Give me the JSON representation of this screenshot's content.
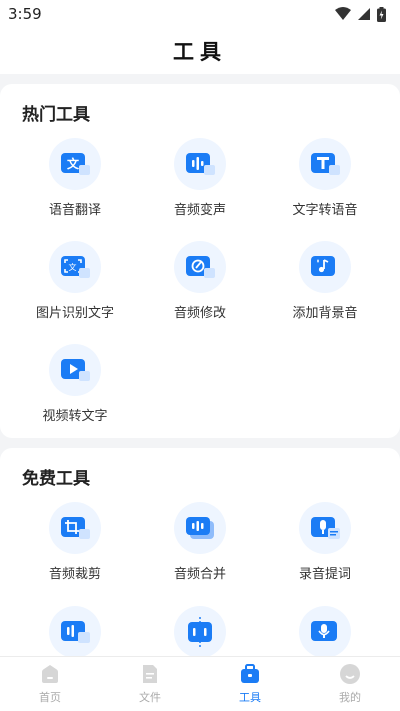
{
  "status_bar": {
    "time": "3:59"
  },
  "header": {
    "title": "工具"
  },
  "hot_tools": {
    "title": "热门工具",
    "items": [
      {
        "label": "语音翻译",
        "icon": "translate-icon"
      },
      {
        "label": "音频变声",
        "icon": "voice-change-icon"
      },
      {
        "label": "文字转语音",
        "icon": "text-to-speech-icon"
      },
      {
        "label": "图片识别文字",
        "icon": "image-ocr-icon"
      },
      {
        "label": "音频修改",
        "icon": "audio-edit-icon"
      },
      {
        "label": "添加背景音",
        "icon": "background-music-icon"
      },
      {
        "label": "视频转文字",
        "icon": "video-to-text-icon"
      }
    ]
  },
  "free_tools": {
    "title": "免费工具",
    "items": [
      {
        "label": "音频裁剪",
        "icon": "crop-audio-icon"
      },
      {
        "label": "音频合并",
        "icon": "merge-audio-icon"
      },
      {
        "label": "录音提词",
        "icon": "teleprompter-icon"
      },
      {
        "label": "",
        "icon": "audio-convert-icon"
      },
      {
        "label": "",
        "icon": "audio-split-icon"
      },
      {
        "label": "",
        "icon": "microphone-icon"
      }
    ]
  },
  "bottom_nav": {
    "items": [
      {
        "label": "首页",
        "icon": "home-icon",
        "active": false
      },
      {
        "label": "文件",
        "icon": "file-icon",
        "active": false
      },
      {
        "label": "工具",
        "icon": "toolbox-icon",
        "active": true
      },
      {
        "label": "我的",
        "icon": "profile-icon",
        "active": false
      }
    ]
  },
  "colors": {
    "accent": "#1b7cf5",
    "icon_bg": "#eef5ff",
    "inactive": "#aaaaaa"
  }
}
